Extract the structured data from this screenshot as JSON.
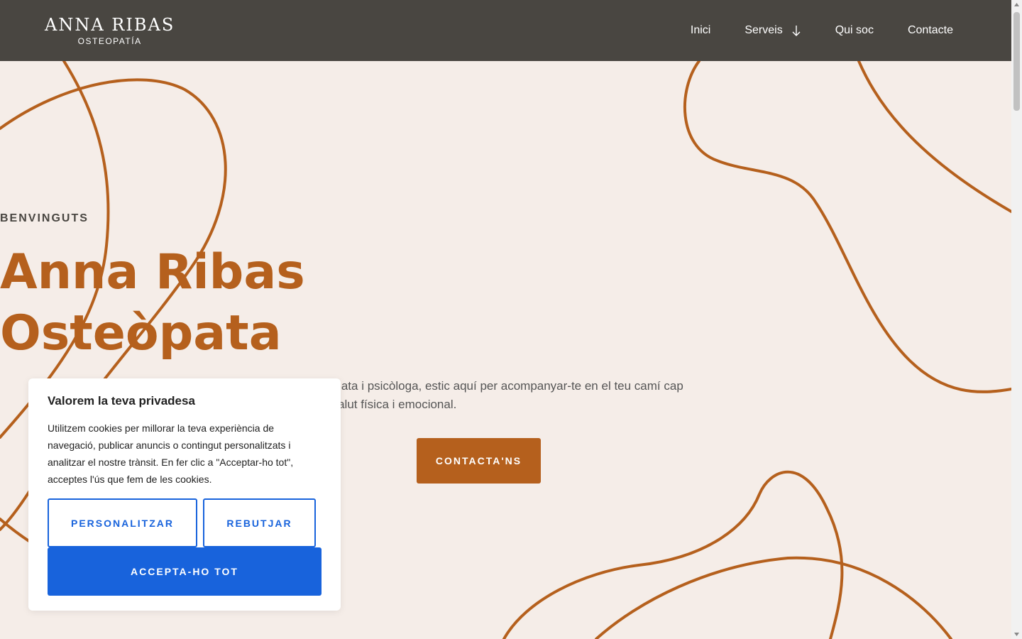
{
  "header": {
    "logo_name": "ANNA RIBAS",
    "logo_sub": "OSTEOPATÍA",
    "nav": [
      {
        "label": "Inici"
      },
      {
        "label": "Serveis"
      },
      {
        "label": "Qui soc"
      },
      {
        "label": "Contacte"
      }
    ]
  },
  "hero": {
    "eyebrow": "BENVINGUTS",
    "title_line1": "Anna Ribas",
    "title_line2": "Osteòpata",
    "subtitle": "Com a osteòpata i psicòloga, estic aquí per acompanyar-te en el teu camí cap a una millor salut física i emocional.",
    "cta": "CONTACTA'NS"
  },
  "cookie": {
    "title": "Valorem la teva privadesa",
    "text": "Utilitzem cookies per millorar la teva experiència de navegació, publicar anuncis o contingut personalitzats i analitzar el nostre trànsit. En fer clic a \"Acceptar-ho tot\", acceptes l'ús que fem de les cookies.",
    "customize": "PERSONALITZAR",
    "reject": "REBUTJAR",
    "accept": "ACCEPTA-HO TOT"
  },
  "colors": {
    "header_bg": "#494641",
    "accent": "#b5601d",
    "background": "#f5ede8",
    "cookie_button": "#1863dc"
  }
}
